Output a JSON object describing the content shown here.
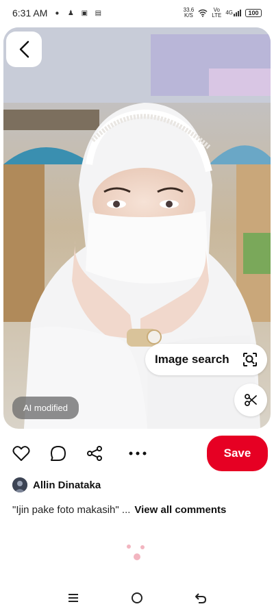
{
  "status_bar": {
    "time": "6:31 AM",
    "net_speed_value": "33.6",
    "net_speed_unit": "K/S",
    "volte_top": "Vo",
    "volte_bottom": "LTE",
    "signal_label": "4G",
    "battery": "100"
  },
  "pin": {
    "ai_badge": "AI modified",
    "image_search_label": "Image search"
  },
  "actions": {
    "save_label": "Save"
  },
  "author": {
    "name": "Allin Dinataka"
  },
  "comment": {
    "text": "\"Ijin pake foto makasih\" ...",
    "view_all": "View all comments"
  },
  "colors": {
    "accent": "#e60023",
    "badge_bg": "#6e6e6e",
    "loader": "#f2b5c0"
  },
  "icons": {
    "back": "chevron-left-icon",
    "image_search": "lens-search-icon",
    "scissors": "scissors-icon",
    "like": "heart-icon",
    "comment": "comment-bubble-icon",
    "share": "share-icon",
    "more": "more-dots-icon"
  }
}
